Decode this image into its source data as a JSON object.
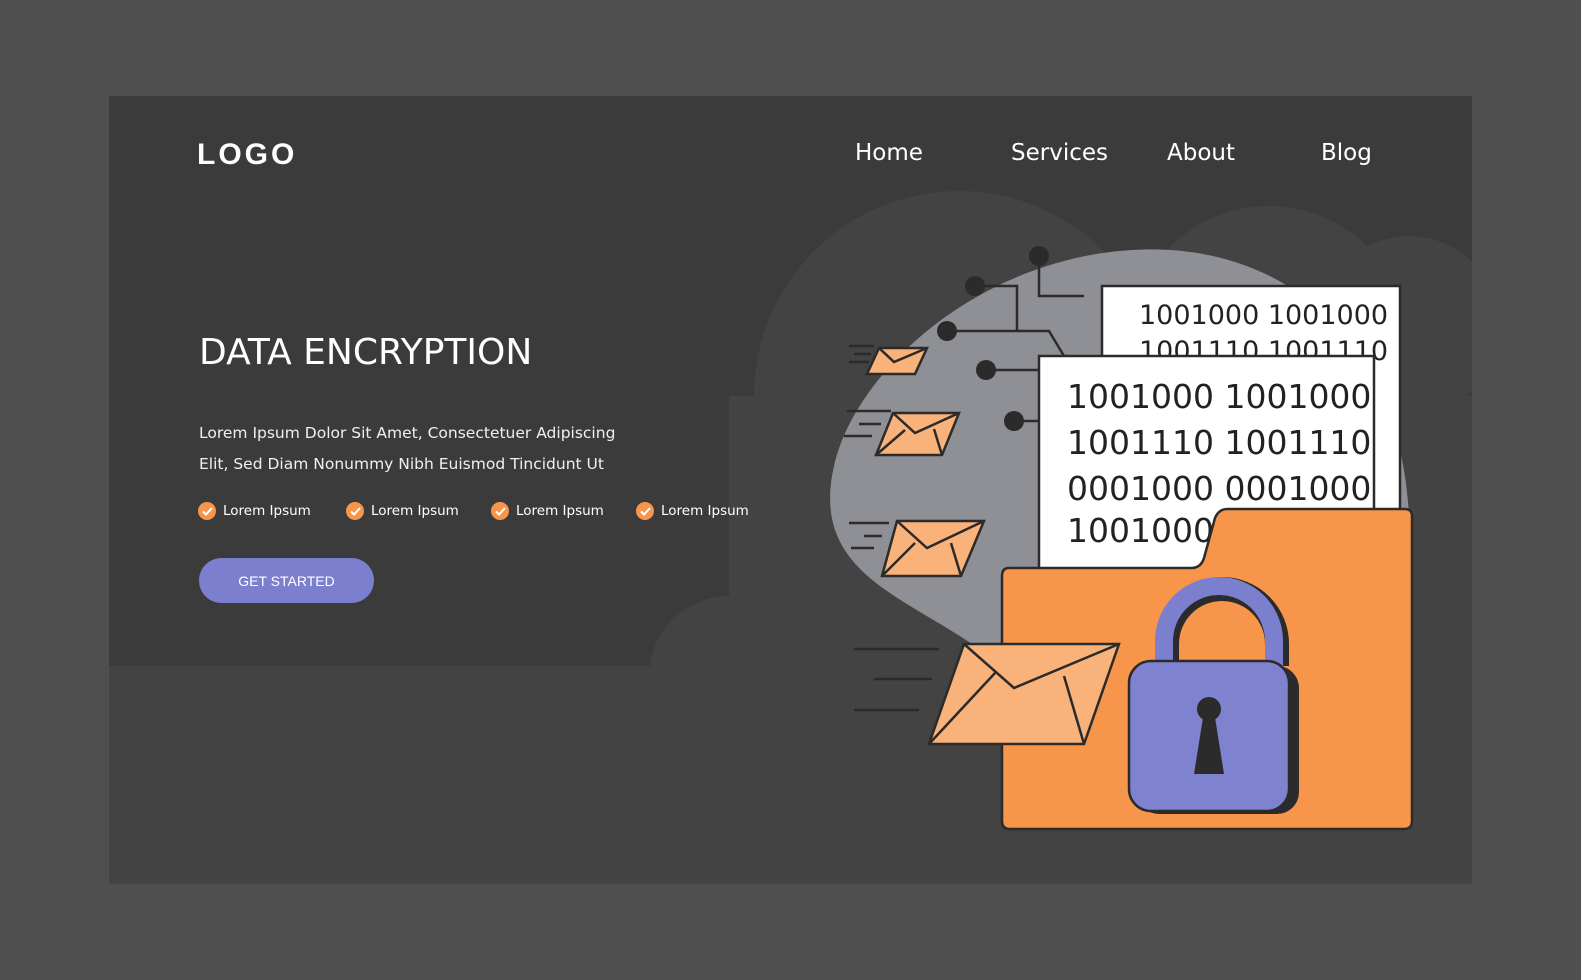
{
  "header": {
    "logo": "LOGO",
    "nav": [
      {
        "label": "Home"
      },
      {
        "label": "Services"
      },
      {
        "label": "About"
      },
      {
        "label": "Blog"
      }
    ]
  },
  "hero": {
    "title": "DATA ENCRYPTION",
    "description_line1": "Lorem Ipsum Dolor Sit Amet, Consectetuer Adipiscing",
    "description_line2": "Elit, Sed Diam Nonummy Nibh Euismod Tincidunt Ut",
    "features": [
      {
        "label": "Lorem Ipsum",
        "icon": "check-icon"
      },
      {
        "label": "Lorem Ipsum",
        "icon": "check-icon"
      },
      {
        "label": "Lorem Ipsum",
        "icon": "check-icon"
      },
      {
        "label": "Lorem Ipsum",
        "icon": "check-icon"
      }
    ],
    "cta_label": "GET STARTED"
  },
  "illustration": {
    "back_doc": [
      "1001000 1001000",
      "1001110 1001110"
    ],
    "front_doc": [
      "1001000 1001000",
      "1001110 1001110",
      "0001000 0001000",
      "1001000 1"
    ]
  },
  "colors": {
    "accent": "#7b7fce",
    "orange": "#f7964a",
    "envelope": "#f9b27a",
    "blob": "#8e9095"
  }
}
